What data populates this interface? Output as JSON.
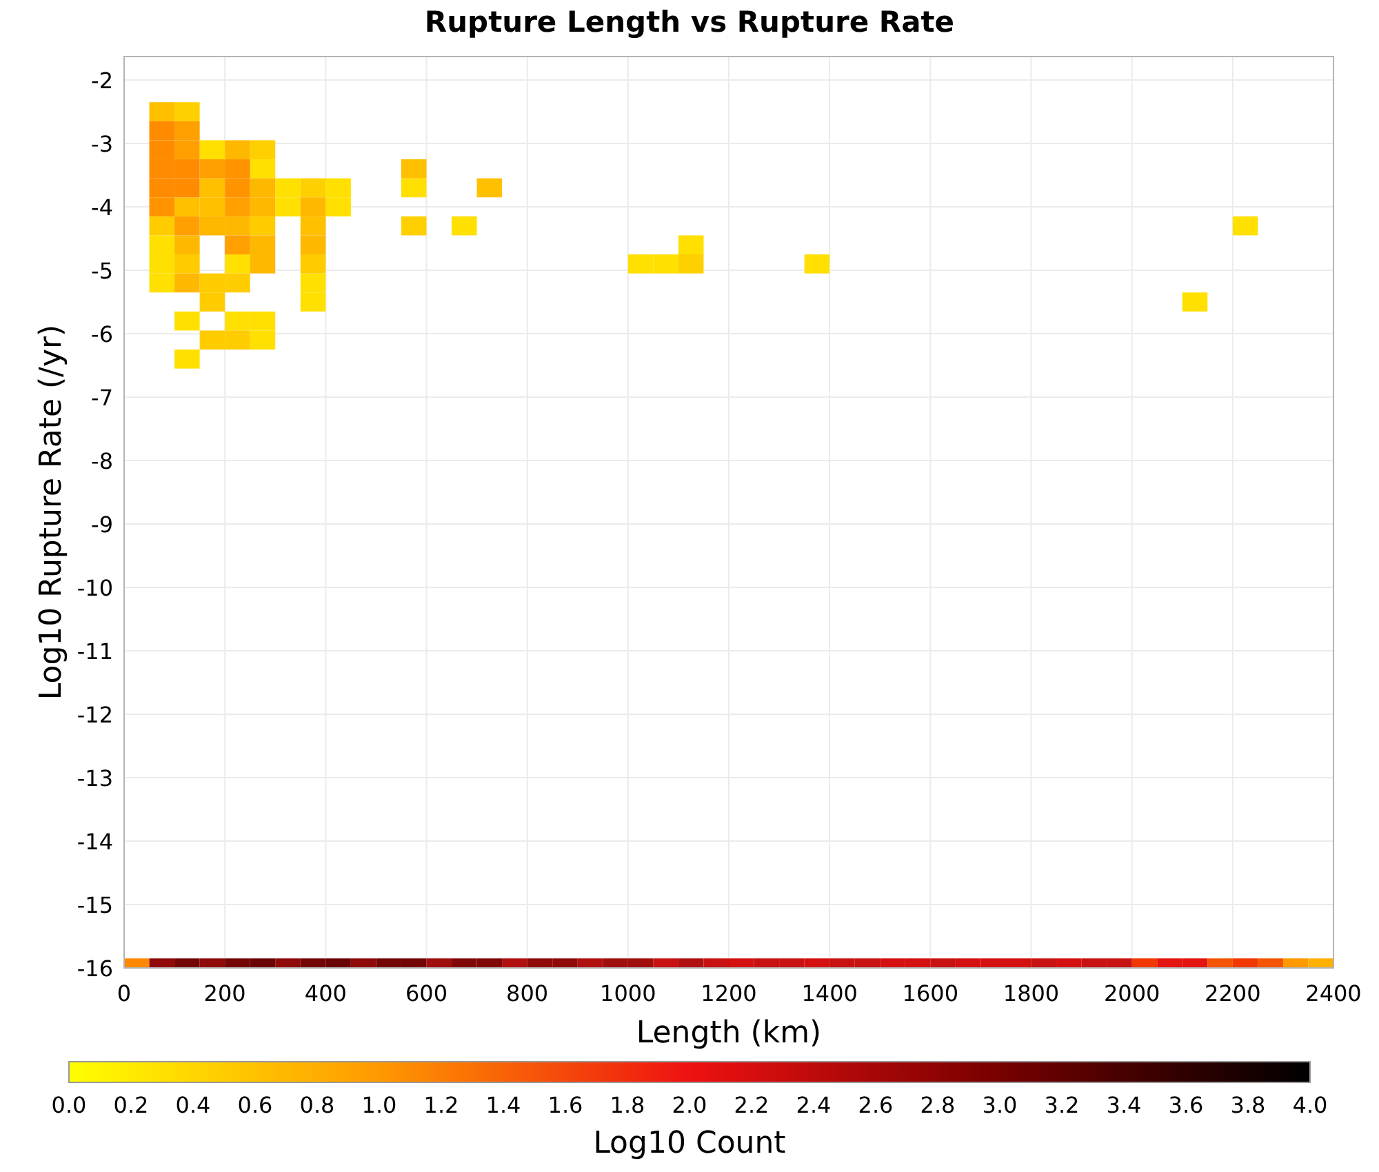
{
  "chart_data": {
    "type": "scatter",
    "grid": true,
    "title": "Rupture Length vs Rupture Rate",
    "xlabel": "Length (km)",
    "ylabel": "Log10 Rupture Rate (/yr)",
    "xlim": [
      0,
      2400
    ],
    "ylim": [
      -16,
      -1.63
    ],
    "xticks": [
      0,
      200,
      400,
      600,
      800,
      1000,
      1200,
      1400,
      1600,
      1800,
      2000,
      2200,
      2400
    ],
    "yticks": [
      -2,
      -3,
      -4,
      -5,
      -6,
      -7,
      -8,
      -9,
      -10,
      -11,
      -12,
      -13,
      -14,
      -15,
      -16
    ],
    "series": [
      {
        "color": "#ffe000",
        "x": [
          175,
          275,
          325,
          425,
          325,
          425,
          75,
          75,
          225,
          75,
          375,
          375,
          125,
          225,
          275,
          275,
          125,
          575,
          675,
          1025,
          1075,
          1125,
          1375,
          2225,
          2125
        ],
        "values": [
          -3.1,
          -3.4,
          -3.7,
          -3.7,
          -4.0,
          -4.0,
          -4.6,
          -4.9,
          -4.9,
          -5.2,
          -5.2,
          -5.5,
          -5.8,
          -5.8,
          -5.8,
          -6.1,
          -6.4,
          -3.7,
          -4.3,
          -4.9,
          -4.9,
          -4.6,
          -4.9,
          -4.3,
          -5.5
        ]
      },
      {
        "color": "#ffd000",
        "x": [
          125,
          275,
          375,
          575,
          1125
        ],
        "values": [
          -2.5,
          -3.1,
          -3.7,
          -4.3,
          -4.9
        ]
      },
      {
        "color": "#ffcc00",
        "x": [
          75,
          275,
          125,
          375,
          175,
          225,
          175,
          175,
          225
        ],
        "values": [
          -4.3,
          -4.3,
          -4.9,
          -4.9,
          -5.2,
          -5.2,
          -5.5,
          -6.1,
          -6.1
        ]
      },
      {
        "color": "#ffc000",
        "x": [
          75,
          175,
          125,
          175,
          375,
          575,
          725
        ],
        "values": [
          -2.5,
          -3.7,
          -4.0,
          -4.0,
          -4.3,
          -3.4,
          -3.7
        ]
      },
      {
        "color": "#ffb800",
        "x": [
          225,
          275,
          275,
          375,
          175,
          225,
          125,
          275,
          375,
          275,
          125
        ],
        "values": [
          -3.1,
          -3.7,
          -4.0,
          -4.0,
          -4.3,
          -4.3,
          -4.6,
          -4.6,
          -4.6,
          -4.9,
          -5.2
        ]
      },
      {
        "color": "#ffa000",
        "x": [
          125,
          125,
          175,
          225,
          125,
          225
        ],
        "values": [
          -2.8,
          -3.1,
          -3.4,
          -4.0,
          -4.3,
          -4.6
        ]
      },
      {
        "color": "#ff9400",
        "x": [
          225,
          225,
          75
        ],
        "values": [
          -3.4,
          -3.7,
          -4.0
        ]
      },
      {
        "color": "#ff8c00",
        "x": [
          75,
          75,
          75,
          125,
          75,
          125
        ],
        "values": [
          -2.8,
          -3.1,
          -3.4,
          -3.4,
          -3.7,
          -3.7
        ]
      },
      {
        "color": "#ff8800",
        "x": [
          25
        ],
        "values": [
          -16
        ]
      },
      {
        "color": "#ffb000",
        "x": [
          2375
        ],
        "values": [
          -16
        ]
      },
      {
        "color": "#ff9900",
        "x": [
          2325
        ],
        "values": [
          -16
        ]
      },
      {
        "color": "#f55400",
        "x": [
          2175,
          2275
        ],
        "values": [
          -16,
          -16
        ]
      },
      {
        "color": "#f03800",
        "x": [
          2025,
          2225
        ],
        "values": [
          -16,
          -16
        ]
      },
      {
        "color": "#e41410",
        "x": [
          2075,
          2125
        ],
        "values": [
          -16,
          -16
        ]
      },
      {
        "color": "#d41010",
        "x": [
          1225,
          1375,
          1525,
          1575,
          1675,
          1725,
          1775,
          1875
        ],
        "values": [
          -16,
          -16,
          -16,
          -16,
          -16,
          -16,
          -16,
          -16
        ]
      },
      {
        "color": "#c81212",
        "x": [
          1075,
          1175,
          1275,
          1325,
          1425,
          1475,
          1625,
          1825,
          1925,
          1975
        ],
        "values": [
          -16,
          -16,
          -16,
          -16,
          -16,
          -16,
          -16,
          -16,
          -16,
          -16
        ]
      },
      {
        "color": "#b01010",
        "x": [
          775,
          925,
          1125
        ],
        "values": [
          -16,
          -16,
          -16
        ]
      },
      {
        "color": "#a00e0e",
        "x": [
          625,
          975,
          1025
        ],
        "values": [
          -16,
          -16,
          -16
        ]
      },
      {
        "color": "#900a0a",
        "x": [
          75,
          175,
          325,
          475,
          825,
          875
        ],
        "values": [
          -16,
          -16,
          -16,
          -16,
          -16,
          -16
        ]
      },
      {
        "color": "#800808",
        "x": [
          675,
          725
        ],
        "values": [
          -16,
          -16
        ]
      },
      {
        "color": "#740505",
        "x": [
          125,
          225,
          375,
          525,
          575
        ],
        "values": [
          -16,
          -16,
          -16,
          -16,
          -16
        ]
      },
      {
        "color": "#6b0404",
        "x": [
          275,
          425
        ],
        "values": [
          -16,
          -16
        ]
      }
    ]
  },
  "colorbar": {
    "label": "Log10 Count",
    "ticks": [
      "0.0",
      "0.2",
      "0.4",
      "0.6",
      "0.8",
      "1.0",
      "1.2",
      "1.4",
      "1.6",
      "1.8",
      "2.0",
      "2.2",
      "2.4",
      "2.6",
      "2.8",
      "3.0",
      "3.2",
      "3.4",
      "3.6",
      "3.8",
      "4.0"
    ]
  }
}
